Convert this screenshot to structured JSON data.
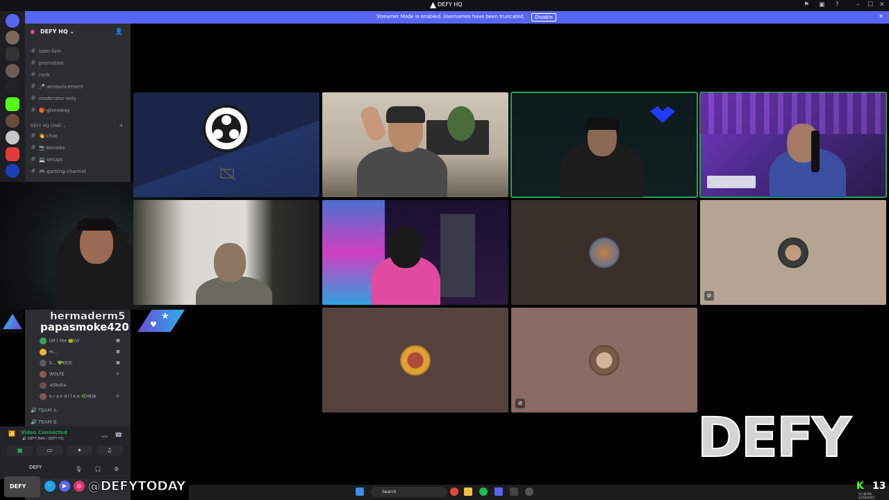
{
  "window": {
    "title": "DEFY HQ",
    "controls": [
      "⚑",
      "▣",
      "?",
      "–",
      "☐",
      "✕"
    ]
  },
  "banner": {
    "message": "Streamer Mode is enabled. Usernames have been truncated.",
    "disable_label": "Disable",
    "close": "✕"
  },
  "server": {
    "name": "DEFY HQ ⌄"
  },
  "channels": [
    {
      "name": "later-fam"
    },
    {
      "name": "promotion"
    },
    {
      "name": "rank"
    },
    {
      "name": "🎤-announcement"
    },
    {
      "name": "moderator-only"
    },
    {
      "name": "🎁-giveaway"
    }
  ],
  "category": {
    "name": "DEFY HQ CHAT ⌄",
    "add": "+"
  },
  "chat_channels": [
    {
      "name": "👋-chat"
    },
    {
      "name": "📷-bovada"
    },
    {
      "name": "💻-setups"
    },
    {
      "name": "🎮-gaming-channel"
    }
  ],
  "overlay_names": {
    "line1": "hermaderm5",
    "line2": "papasmoke420"
  },
  "voice_users": [
    {
      "name": "LVI | Fite",
      "tag": "🐸LVI",
      "color": "#3ba55c"
    },
    {
      "name": "m...",
      "tag": "",
      "color": "#f0b232"
    },
    {
      "name": "S...",
      "tag": "💚KICK",
      "color": "#5c5e66"
    },
    {
      "name": "WOLFE",
      "tag": "",
      "color": "#8e5b4a"
    },
    {
      "name": "☠Skull☠",
      "tag": "",
      "color": "#6b4f46"
    },
    {
      "name": "b r a n d i l e e",
      "tag": "🌿HKIA",
      "color": "#7a5a50"
    }
  ],
  "voice_channels": [
    {
      "name": "TEAM A"
    },
    {
      "name": "TEAM B"
    }
  ],
  "voice_panel": {
    "status": "Video Connected",
    "channel": "🔊 DEFY BAR / DEFY HQ"
  },
  "user_panel": {
    "name": "DEFY"
  },
  "tiles": [
    {
      "type": "obs",
      "speaking": false
    },
    {
      "type": "video",
      "scene": "office",
      "speaking": false
    },
    {
      "type": "video",
      "scene": "dark",
      "speaking": true
    },
    {
      "type": "video",
      "scene": "purple",
      "speaking": true
    },
    {
      "type": "video",
      "scene": "plain",
      "speaking": false
    },
    {
      "type": "video",
      "scene": "pink",
      "speaking": false
    },
    {
      "type": "avatar",
      "bg": "#3b2f2a",
      "avatar": "#4a6fa5",
      "muted": false
    },
    {
      "type": "avatar",
      "bg": "#b5a493",
      "avatar": "#3a3a3a",
      "muted": true
    },
    {
      "type": "avatar",
      "bg": "#55423f",
      "avatar": "#e0a033",
      "muted": false
    },
    {
      "type": "avatar",
      "bg": "#8a6a62",
      "avatar": "#c9a48c",
      "muted": true
    }
  ],
  "brand_logo": "DEFY",
  "social": {
    "handle": "@DEFYTODAY",
    "avatar_label": "DEFY",
    "icons": [
      "🐦",
      "▶",
      "◎"
    ]
  },
  "taskbar": {
    "search": "Search"
  },
  "kick": {
    "logo": "K",
    "count": "13"
  },
  "clock": {
    "time": "11:48 PM",
    "date": "12/18/2025"
  }
}
